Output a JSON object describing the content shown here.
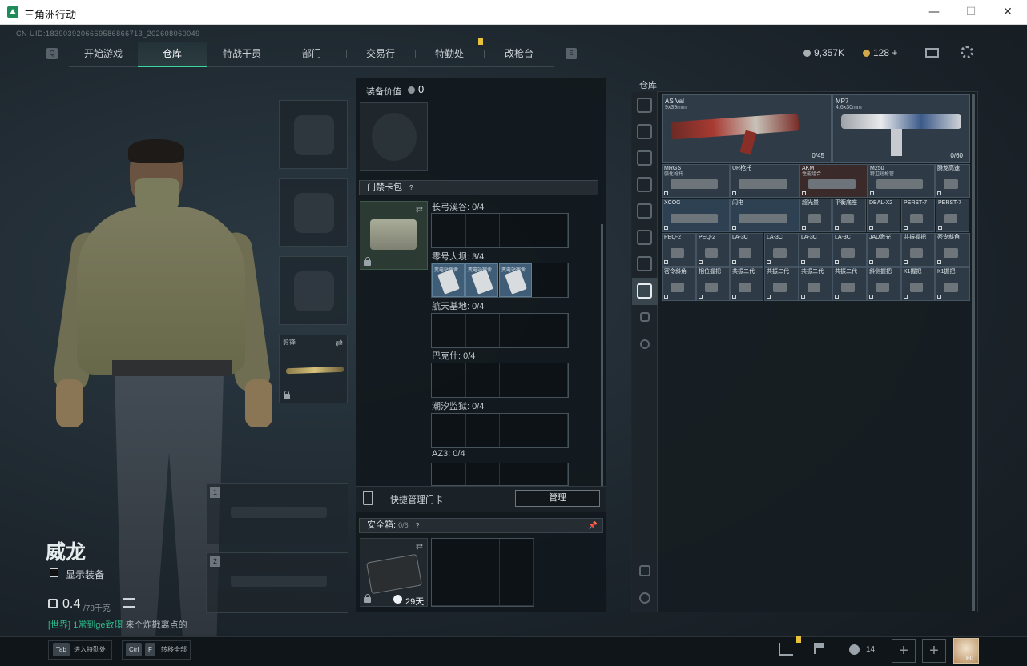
{
  "window": {
    "title": "三角洲行动",
    "controls": [
      "—",
      "☐",
      "✕"
    ]
  },
  "uid": "CN UID:1839039206669586866713_202608060049",
  "nav": {
    "left_key": "Q",
    "right_key": "E",
    "tabs": [
      "开始游戏",
      "仓库",
      "特战干员",
      "部门",
      "交易行",
      "特勤处",
      "改枪台"
    ],
    "active_tab": "仓库"
  },
  "currency": {
    "silver": "9,357K",
    "gold": "128 +"
  },
  "character": {
    "name": "威龙",
    "show_equipment": "显示装备",
    "weight": "0.4",
    "weight_max": "/78千克",
    "melee_label": "影锋"
  },
  "weapon_slots": [
    "1",
    "2"
  ],
  "chat": {
    "channel": "[世界]",
    "user": "1常到ge致璟",
    "message": "来个炸戡离点的"
  },
  "equipment_panel": {
    "value_label": "装备价值",
    "value": "0",
    "keycard_bar": "门禁卡包",
    "help": "?",
    "zones": [
      {
        "label": "长弓溪谷: 0/4"
      },
      {
        "label": "零号大坝: 3/4"
      },
      {
        "label": "航天基地: 0/4"
      },
      {
        "label": "巴克什: 0/4"
      },
      {
        "label": "潮汐监狱: 0/4"
      },
      {
        "label": "AZ3: 0/4"
      }
    ],
    "cards": [
      "变电站宿舍",
      "变电站宿舍",
      "变电站宿舍"
    ],
    "quick_manage": "快捷管理门卡",
    "manage_button": "管理",
    "safebox_label": "安全箱:",
    "safebox_count": "0/6",
    "safebox_days": "29天",
    "pin": "📌"
  },
  "warehouse": {
    "title": "仓库",
    "guns": [
      {
        "name": "AS Val",
        "caliber": "9x39mm",
        "ammo": "0/45"
      },
      {
        "name": "MP7",
        "caliber": "4.6x30mm",
        "ammo": "0/60"
      }
    ],
    "rows": [
      [
        {
          "name": "MRGS",
          "sub": "强化枪托"
        },
        {
          "name": "UR枪托",
          "sub": ""
        },
        {
          "name": "AKM",
          "sub": "性能组合"
        },
        {
          "name": "M250",
          "sub": "特卫短枪管"
        },
        {
          "name": "腾龙高速",
          "sub": ""
        }
      ],
      [
        {
          "name": "XCOG",
          "sub": ""
        },
        {
          "name": "闪电",
          "sub": ""
        },
        {
          "name": "超光量",
          "sub": ""
        },
        {
          "name": "平衡底座",
          "sub": ""
        },
        {
          "name": "DBAL-X2",
          "sub": ""
        },
        {
          "name": "PERST-7",
          "sub": ""
        },
        {
          "name": "PERST-7",
          "sub": ""
        }
      ],
      [
        {
          "name": "PEQ-2",
          "sub": ""
        },
        {
          "name": "PEQ-2",
          "sub": ""
        },
        {
          "name": "LA-3C",
          "sub": ""
        },
        {
          "name": "LA-3C",
          "sub": ""
        },
        {
          "name": "LA-3C",
          "sub": ""
        },
        {
          "name": "LA-3C",
          "sub": ""
        },
        {
          "name": "JAD激光",
          "sub": ""
        },
        {
          "name": "共振握把",
          "sub": ""
        },
        {
          "name": "密令斜角",
          "sub": ""
        }
      ],
      [
        {
          "name": "密令斜角",
          "sub": ""
        },
        {
          "name": "相位握把",
          "sub": ""
        },
        {
          "name": "共振二代",
          "sub": ""
        },
        {
          "name": "共振二代",
          "sub": ""
        },
        {
          "name": "共振二代",
          "sub": ""
        },
        {
          "name": "共振二代",
          "sub": ""
        },
        {
          "name": "斜侧握把",
          "sub": ""
        },
        {
          "name": "K1握把",
          "sub": ""
        },
        {
          "name": "K1握把",
          "sub": ""
        }
      ]
    ]
  },
  "bottom": {
    "tab_key": "Tab",
    "tab_text": "进入特勤处",
    "ctrl_key": "Ctrl",
    "f_key": "F",
    "ctrl_text": "转移全部",
    "friends": "14",
    "plus": "+",
    "level": "80"
  }
}
